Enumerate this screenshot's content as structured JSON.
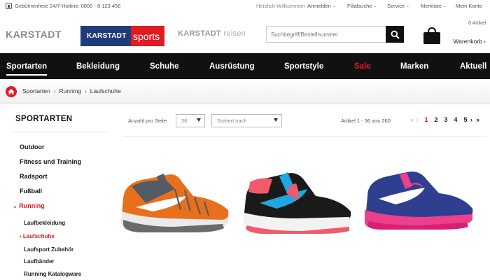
{
  "topbar": {
    "hotline": "Gebührenfreie 24/7-Hotline: 0800 - 8 123 456",
    "welcome": "Herzlich Willkommen",
    "login": "Anmelden",
    "stores": "Filialsuche",
    "service": "Service",
    "wishlist": "Merkliste",
    "account": "Mein Konto"
  },
  "logos": {
    "karstadt": "KARSTADT",
    "sports_left": "KARSTADT",
    "sports_right": "sports",
    "reisen_bold": "KARSTADT",
    "reisen_light": "reisen"
  },
  "search": {
    "placeholder": "Suchbegriff/Bestellnummer"
  },
  "cart": {
    "count": "0 Artikel",
    "label": "Warenkorb ›"
  },
  "nav": {
    "items": [
      {
        "label": "Sportarten"
      },
      {
        "label": "Bekleidung"
      },
      {
        "label": "Schuhe"
      },
      {
        "label": "Ausrüstung"
      },
      {
        "label": "Sportstyle"
      },
      {
        "label": "Sale"
      },
      {
        "label": "Marken"
      },
      {
        "label": "Aktuell"
      }
    ]
  },
  "breadcrumb": {
    "items": [
      "Sportarten",
      "Running",
      "Laufschuhe"
    ]
  },
  "sidebar": {
    "title": "SPORTARTEN",
    "items": [
      {
        "label": "Outdoor"
      },
      {
        "label": "Fitness und Training"
      },
      {
        "label": "Radsport"
      },
      {
        "label": "Fußball"
      },
      {
        "label": "Running"
      }
    ],
    "subitems": [
      {
        "label": "Laufbekleidung"
      },
      {
        "label": "Laufschuhe"
      },
      {
        "label": "Laufsport Zubehör"
      },
      {
        "label": "Laufbänder"
      },
      {
        "label": "Running Katalogware"
      }
    ]
  },
  "toolbar": {
    "per_page_label": "Anzahl pro Seite",
    "per_page_value": "36",
    "sort_value": "Sortiert nach",
    "range": "Artikel 1 - 36 von 260",
    "pages": [
      "1",
      "2",
      "3",
      "4",
      "5"
    ]
  },
  "icons": {
    "phone": "phone-icon",
    "search": "search-icon",
    "cart": "shopping-bag-icon",
    "home": "home-icon"
  },
  "colors": {
    "brand_red": "#e11b22",
    "brand_blue": "#1f3c7a",
    "nav_bg": "#111111"
  }
}
